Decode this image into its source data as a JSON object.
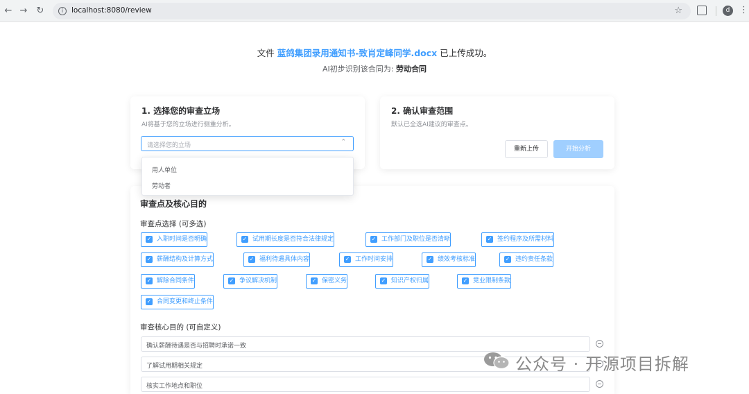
{
  "browser": {
    "url": "localhost:8080/review",
    "profile_initial": "d"
  },
  "upload": {
    "prefix": "文件",
    "filename": "蓝鸽集团录用通知书-致肖定峰同学.docx",
    "suffix": "已上传成功。",
    "ai_prefix": "AI初步识别该合同为:",
    "contract_type": "劳动合同"
  },
  "stance": {
    "title": "1. 选择您的审查立场",
    "desc": "AI将基于您的立场进行侧重分析。",
    "placeholder": "请选择您的立场",
    "options": [
      "用人单位",
      "劳动者"
    ]
  },
  "scope": {
    "title": "2. 确认审查范围",
    "desc": "默认已全选AI建议的审查点。",
    "reupload_label": "重新上传",
    "start_label": "开始分析"
  },
  "review": {
    "title": "审查点及核心目的",
    "points_label": "审查点选择 (可多选)",
    "points": [
      "入职时间是否明确",
      "试用期长度是否符合法律规定",
      "工作部门及职位是否清晰",
      "签约程序及所需材料",
      "薪酬结构及计算方式",
      "福利待遇具体内容",
      "工作时间安排",
      "绩效考核标准",
      "违约责任条款",
      "解除合同条件",
      "争议解决机制",
      "保密义务",
      "知识产权归属",
      "竞业限制条款",
      "合同变更和终止条件"
    ],
    "purpose_label": "审查核心目的 (可自定义)",
    "purposes": [
      "确认薪酬待遇是否与招聘时承诺一致",
      "了解试用期相关规定",
      "核实工作地点和职位"
    ]
  },
  "watermark": {
    "text": "公众号 · 开源项目拆解"
  },
  "colors": {
    "primary": "#409eff",
    "primary_disabled": "#a0cfff"
  }
}
